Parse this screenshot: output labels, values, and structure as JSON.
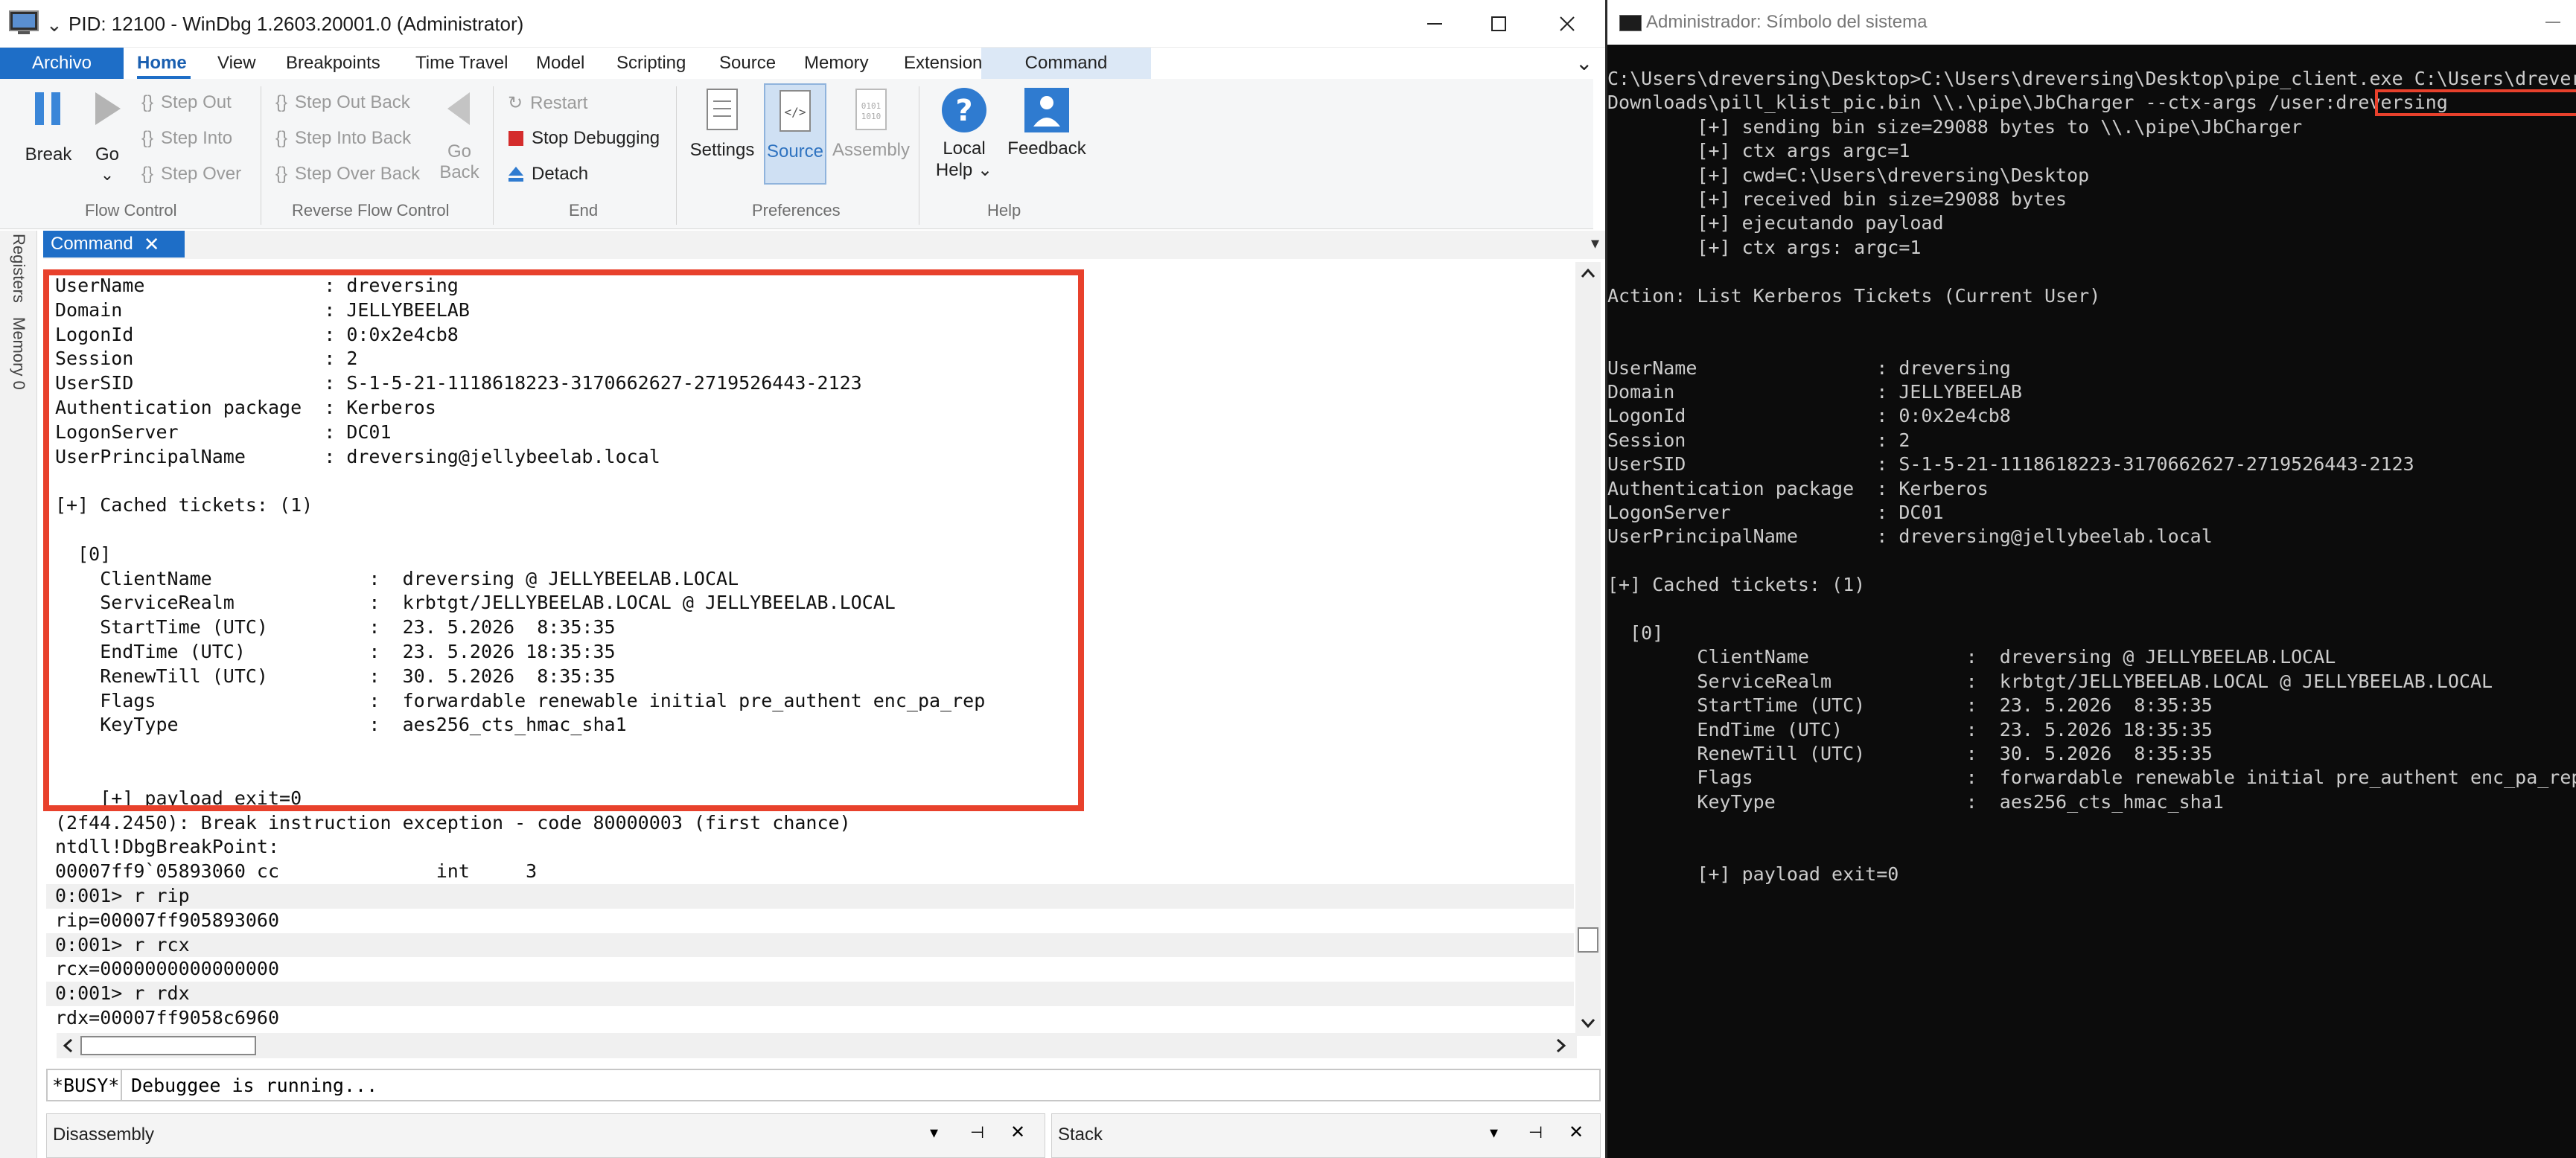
{
  "windbg": {
    "title": "PID: 12100 - WinDbg 1.2603.20001.0 (Administrator)",
    "ribbon_tabs": {
      "file": "Archivo",
      "home": "Home",
      "view": "View",
      "breakpoints": "Breakpoints",
      "time_travel": "Time Travel",
      "model": "Model",
      "scripting": "Scripting",
      "source": "Source",
      "memory": "Memory",
      "extensions": "Extensions",
      "command": "Command"
    },
    "ribbon": {
      "break": "Break",
      "go": "Go",
      "step_out": "Step Out",
      "step_into": "Step Into",
      "step_over": "Step Over",
      "step_out_back": "Step Out Back",
      "step_into_back": "Step Into Back",
      "step_over_back": "Step Over Back",
      "go_back_1": "Go",
      "go_back_2": "Back",
      "restart": "Restart",
      "stop_debugging": "Stop Debugging",
      "detach": "Detach",
      "settings": "Settings",
      "source": "Source",
      "assembly": "Assembly",
      "local_help_1": "Local",
      "local_help_2": "Help",
      "feedback": "Feedback",
      "group_flow": "Flow Control",
      "group_reverse": "Reverse Flow Control",
      "group_end": "End",
      "group_prefs": "Preferences",
      "group_help": "Help"
    },
    "side_tabs": {
      "registers": "Registers",
      "memory": "Memory 0"
    },
    "command_tab": "Command",
    "command_lines": [
      "UserName                : dreversing",
      "Domain                  : JELLYBEELAB",
      "LogonId                 : 0:0x2e4cb8",
      "Session                 : 2",
      "UserSID                 : S-1-5-21-1118618223-3170662627-2719526443-2123",
      "Authentication package  : Kerberos",
      "LogonServer             : DC01",
      "UserPrincipalName       : dreversing@jellybeelab.local",
      "",
      "[+] Cached tickets: (1)",
      "",
      "  [0]",
      "    ClientName              :  dreversing @ JELLYBEELAB.LOCAL",
      "    ServiceRealm            :  krbtgt/JELLYBEELAB.LOCAL @ JELLYBEELAB.LOCAL",
      "    StartTime (UTC)         :  23. 5.2026  8:35:35",
      "    EndTime (UTC)           :  23. 5.2026 18:35:35",
      "    RenewTill (UTC)         :  30. 5.2026  8:35:35",
      "    Flags                   :  forwardable renewable initial pre_authent enc_pa_rep",
      "    KeyType                 :  aes256_cts_hmac_sha1",
      "",
      "",
      "    [+] payload exit=0",
      "(2f44.2450): Break instruction exception - code 80000003 (first chance)",
      "ntdll!DbgBreakPoint:",
      "00007ff9`05893060 cc              int     3",
      "0:001> r rip",
      "rip=00007ff905893060",
      "0:001> r rcx",
      "rcx=0000000000000000",
      "0:001> r rdx",
      "rdx=00007ff9058c6960"
    ],
    "busy": "*BUSY*",
    "status_text": "Debuggee is running...",
    "panes": {
      "disassembly": "Disassembly",
      "stack": "Stack"
    }
  },
  "console": {
    "title": "Administrador: Símbolo del sistema",
    "lines": [
      "C:\\Users\\dreversing\\Desktop>C:\\Users\\dreversing\\Desktop\\pipe_client.exe C:\\Users\\dreversing\\",
      "Downloads\\pill_klist_pic.bin \\\\.\\pipe\\JbCharger --ctx-args /user:dreversing",
      "        [+] sending bin size=29088 bytes to \\\\.\\pipe\\JbCharger",
      "        [+] ctx args argc=1",
      "        [+] cwd=C:\\Users\\dreversing\\Desktop",
      "        [+] received bin size=29088 bytes",
      "        [+] ejecutando payload",
      "        [+] ctx args: argc=1",
      "",
      "Action: List Kerberos Tickets (Current User)",
      "",
      "",
      "UserName                : dreversing",
      "Domain                  : JELLYBEELAB",
      "LogonId                 : 0:0x2e4cb8",
      "Session                 : 2",
      "UserSID                 : S-1-5-21-1118618223-3170662627-2719526443-2123",
      "Authentication package  : Kerberos",
      "LogonServer             : DC01",
      "UserPrincipalName       : dreversing@jellybeelab.local",
      "",
      "[+] Cached tickets: (1)",
      "",
      "  [0]",
      "        ClientName              :  dreversing @ JELLYBEELAB.LOCAL",
      "        ServiceRealm            :  krbtgt/JELLYBEELAB.LOCAL @ JELLYBEELAB.LOCAL",
      "        StartTime (UTC)         :  23. 5.2026  8:35:35",
      "        EndTime (UTC)           :  23. 5.2026 18:35:35",
      "        RenewTill (UTC)         :  30. 5.2026  8:35:35",
      "        Flags                   :  forwardable renewable initial pre_authent enc_pa_rep",
      "        KeyType                 :  aes256_cts_hmac_sha1",
      "",
      "",
      "        [+] payload exit=0"
    ]
  },
  "colors": {
    "accent": "#1e6ec7",
    "highlight_box": "#e8412c",
    "console_bg": "#0c0c0c",
    "console_text": "#cccccc"
  },
  "icons": {
    "app": "windbg-app-icon",
    "console": "cmd-icon",
    "break": "pause-icon",
    "go": "play-icon",
    "stop": "stop-icon",
    "detach": "eject-icon",
    "help": "question-icon",
    "feedback": "feedback-icon"
  }
}
